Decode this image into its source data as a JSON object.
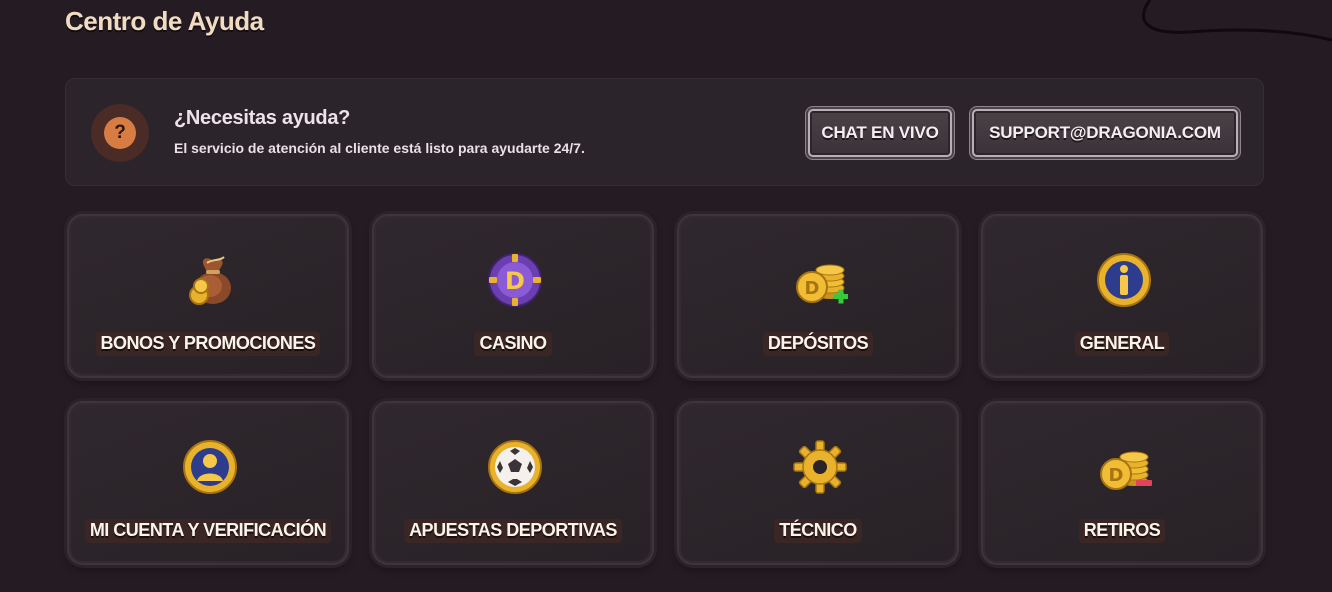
{
  "page_title": "Centro de Ayuda",
  "help": {
    "title": "¿Necesitas ayuda?",
    "subtitle": "El servicio de atención al cliente está listo para ayudarte 24/7.",
    "icon_glyph": "?",
    "icon": "question-icon"
  },
  "buttons": {
    "chat": "CHAT EN VIVO",
    "email": "SUPPORT@DRAGONIA.COM"
  },
  "categories": [
    {
      "label": "BONOS Y PROMOCIONES",
      "icon": "money-bag-icon"
    },
    {
      "label": "CASINO",
      "icon": "casino-chip-icon"
    },
    {
      "label": "DEPÓSITOS",
      "icon": "coins-plus-icon"
    },
    {
      "label": "GENERAL",
      "icon": "info-coin-icon"
    },
    {
      "label": "MI CUENTA Y VERIFICACIÓN",
      "icon": "user-coin-icon"
    },
    {
      "label": "APUESTAS DEPORTIVAS",
      "icon": "soccer-ball-icon"
    },
    {
      "label": "TÉCNICO",
      "icon": "gear-icon"
    },
    {
      "label": "RETIROS",
      "icon": "coins-minus-icon"
    }
  ],
  "colors": {
    "background": "#241b23",
    "title": "#f1dcc3",
    "accent_orange": "#d77d43",
    "gold": "#e8b22c",
    "plus_green": "#39c93d",
    "minus_red": "#e0455a"
  }
}
